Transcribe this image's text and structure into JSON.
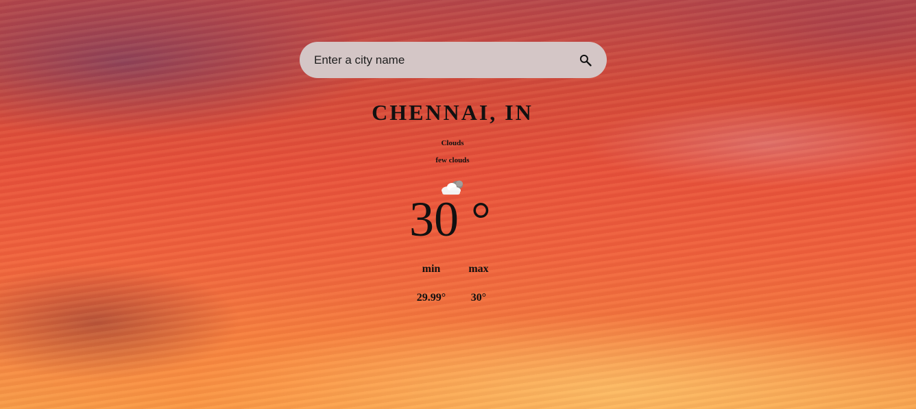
{
  "search": {
    "placeholder": "Enter a city name",
    "icon": "search-icon"
  },
  "weather": {
    "location": "CHENNAI, IN",
    "main": "Clouds",
    "description": "few clouds",
    "icon": "few-clouds-icon",
    "temperature": "30 °",
    "min_label": "min",
    "max_label": "max",
    "min_value": "29.99°",
    "max_value": "30°"
  },
  "colors": {
    "search_bg": "#d4c6c6",
    "text": "#111111",
    "sky_top": "#b4454a",
    "sky_bottom": "#f8a04a"
  }
}
